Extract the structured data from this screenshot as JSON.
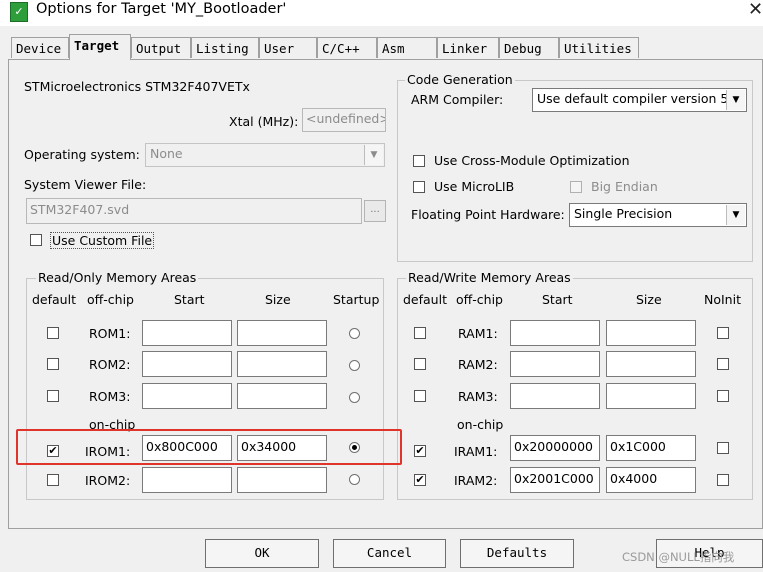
{
  "window": {
    "title": "Options for Target 'MY_Bootloader'"
  },
  "tabs": [
    {
      "label": "Device"
    },
    {
      "label": "Target"
    },
    {
      "label": "Output"
    },
    {
      "label": "Listing"
    },
    {
      "label": "User"
    },
    {
      "label": "C/C++"
    },
    {
      "label": "Asm"
    },
    {
      "label": "Linker"
    },
    {
      "label": "Debug"
    },
    {
      "label": "Utilities"
    }
  ],
  "target": {
    "device_name": "STMicroelectronics STM32F407VETx",
    "xtal_label": "Xtal (MHz):",
    "xtal_value": "<undefined>",
    "os_label": "Operating system:",
    "os_value": "None",
    "svf_label": "System Viewer File:",
    "svf_value": "STM32F407.svd",
    "browse": "...",
    "custom_file_label": "Use Custom File"
  },
  "codegen": {
    "title": "Code Generation",
    "compiler_label": "ARM Compiler:",
    "compiler_value": "Use default compiler version 5",
    "cross_module": "Use Cross-Module Optimization",
    "microlib": "Use MicroLIB",
    "big_endian": "Big Endian",
    "fp_label": "Floating Point Hardware:",
    "fp_value": "Single Precision"
  },
  "rom": {
    "title": "Read/Only Memory Areas",
    "headers": {
      "default": "default",
      "offchip": "off-chip",
      "start": "Start",
      "size": "Size",
      "startup": "Startup"
    },
    "onchip_label": "on-chip",
    "rows": [
      {
        "name": "ROM1:",
        "start": "",
        "size": "",
        "default": false,
        "startup": false
      },
      {
        "name": "ROM2:",
        "start": "",
        "size": "",
        "default": false,
        "startup": false
      },
      {
        "name": "ROM3:",
        "start": "",
        "size": "",
        "default": false,
        "startup": false
      },
      {
        "name": "IROM1:",
        "start": "0x800C000",
        "size": "0x34000",
        "default": true,
        "startup": true
      },
      {
        "name": "IROM2:",
        "start": "",
        "size": "",
        "default": false,
        "startup": false
      }
    ]
  },
  "ram": {
    "title": "Read/Write Memory Areas",
    "headers": {
      "default": "default",
      "offchip": "off-chip",
      "start": "Start",
      "size": "Size",
      "noinit": "NoInit"
    },
    "onchip_label": "on-chip",
    "rows": [
      {
        "name": "RAM1:",
        "start": "",
        "size": "",
        "default": false,
        "noinit": false
      },
      {
        "name": "RAM2:",
        "start": "",
        "size": "",
        "default": false,
        "noinit": false
      },
      {
        "name": "RAM3:",
        "start": "",
        "size": "",
        "default": false,
        "noinit": false
      },
      {
        "name": "IRAM1:",
        "start": "0x20000000",
        "size": "0x1C000",
        "default": true,
        "noinit": false
      },
      {
        "name": "IRAM2:",
        "start": "0x2001C000",
        "size": "0x4000",
        "default": true,
        "noinit": false
      }
    ]
  },
  "buttons": {
    "ok": "OK",
    "cancel": "Cancel",
    "defaults": "Defaults",
    "help": "Help"
  },
  "watermark": "CSDN @NULL指向我",
  "colors": {
    "highlight": "#e0342b",
    "app_icon": "#2e9e3a"
  }
}
